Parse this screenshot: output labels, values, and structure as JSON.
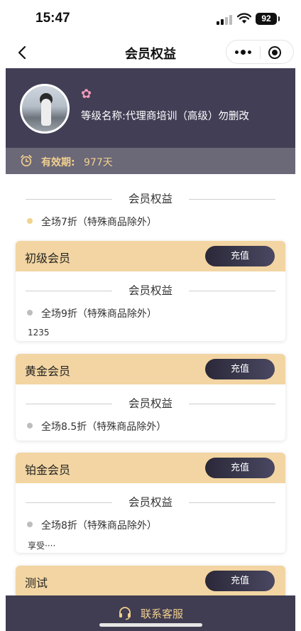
{
  "status_bar": {
    "time": "15:47",
    "battery": "92"
  },
  "nav": {
    "title": "会员权益"
  },
  "profile": {
    "level_name": "等级名称:代理商培训（高级）勿删改",
    "validity_label": "有效期:",
    "validity_value": "977天"
  },
  "current_benefits": {
    "title": "会员权益",
    "items": [
      "全场7折（特殊商品除外）"
    ]
  },
  "levels": [
    {
      "name": "初级会员",
      "button": "充值",
      "benefits_title": "会员权益",
      "benefit": "全场9折（特殊商品除外）",
      "note": "1235"
    },
    {
      "name": "黄金会员",
      "button": "充值",
      "benefits_title": "会员权益",
      "benefit": "全场8.5折（特殊商品除外）",
      "note": ""
    },
    {
      "name": "铂金会员",
      "button": "充值",
      "benefits_title": "会员权益",
      "benefit": "全场8折（特殊商品除外）",
      "note": "享受····"
    },
    {
      "name": "测试",
      "button": "充值"
    }
  ],
  "bottom_bar": {
    "service_label": "联系客服"
  },
  "colors": {
    "header_bg": "#413e55",
    "validity_bg": "#6b6878",
    "gold_text": "#f2d08d",
    "card_head": "#f2d5a2",
    "button_dark": "#2a2838",
    "gold_dot": "#f0d48c",
    "gray_dot": "#bdbdbd"
  },
  "icons": [
    "back-arrow-icon",
    "more-dots-icon",
    "close-mini-program-icon",
    "flower-icon",
    "alarm-clock-icon",
    "headset-icon"
  ]
}
